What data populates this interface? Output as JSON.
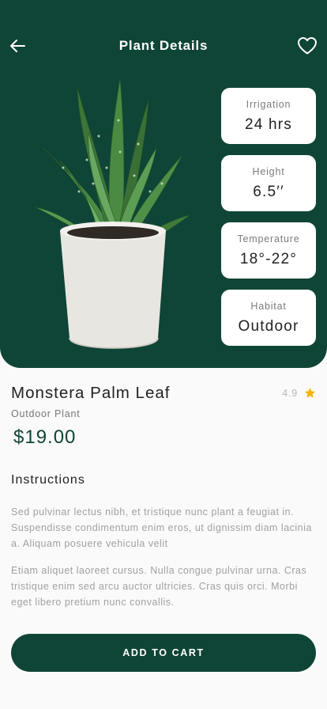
{
  "header": {
    "title": "Plant Details",
    "back_icon": "arrow-left-icon",
    "favorite_icon": "heart-outline-icon"
  },
  "specs": [
    {
      "label": "Irrigation",
      "value": "24 hrs"
    },
    {
      "label": "Height",
      "value": "6.5′′"
    },
    {
      "label": "Temperature",
      "value": "18°-22°"
    },
    {
      "label": "Habitat",
      "value": "Outdoor"
    }
  ],
  "product": {
    "name": "Monstera Palm Leaf",
    "type": "Outdoor Plant",
    "price": "$19.00",
    "rating": "4.9",
    "rating_icon": "star-icon"
  },
  "instructions": {
    "heading": "Instructions",
    "paragraphs": [
      "Sed pulvinar lectus nibh, et tristique nunc plant a feugiat in. Suspendisse condimentum enim eros, ut dignissim diam lacinia a. Aliquam posuere vehicula velit",
      "Etiam aliquet laoreet cursus. Nulla congue pulvinar urna. Cras tristique enim sed arcu auctor ultricies. Cras quis orci. Morbi eget libero pretium nunc convallis."
    ]
  },
  "cta": {
    "label": "ADD TO CART"
  },
  "colors": {
    "brand": "#0f4536",
    "star": "#f5b400",
    "background": "#fafafa"
  }
}
